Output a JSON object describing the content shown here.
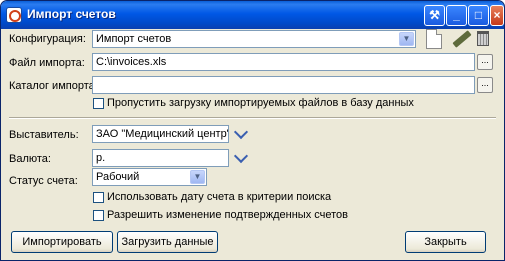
{
  "window": {
    "title": "Импорт счетов"
  },
  "config": {
    "label": "Конфигурация:",
    "value": "Импорт счетов"
  },
  "import_file": {
    "label": "Файл импорта:",
    "value": "C:\\invoices.xls",
    "browse": "..."
  },
  "import_dir": {
    "label": "Каталог импорта:",
    "value": "",
    "browse": "..."
  },
  "skip_upload": {
    "label": "Пропустить загрузку импортируемых файлов в базу данных",
    "checked": false
  },
  "issuer": {
    "label": "Выставитель:",
    "value": "ЗАО \"Медицинский центр\""
  },
  "currency": {
    "label": "Валюта:",
    "value": "р."
  },
  "status": {
    "label": "Статус счета:",
    "value": "Рабочий"
  },
  "use_date": {
    "label": "Использовать дату счета в критерии поиска",
    "checked": false
  },
  "allow_change": {
    "label": "Разрешить изменение подтвержденных счетов",
    "checked": false
  },
  "buttons": {
    "import": "Импортировать",
    "load": "Загрузить данные",
    "close": "Закрыть"
  },
  "icons": [
    "app-icon",
    "tools-icon",
    "minimize-icon",
    "maximize-icon",
    "close-icon",
    "new-document-icon",
    "edit-pencil-icon",
    "trash-icon",
    "chevron-down-icon"
  ]
}
